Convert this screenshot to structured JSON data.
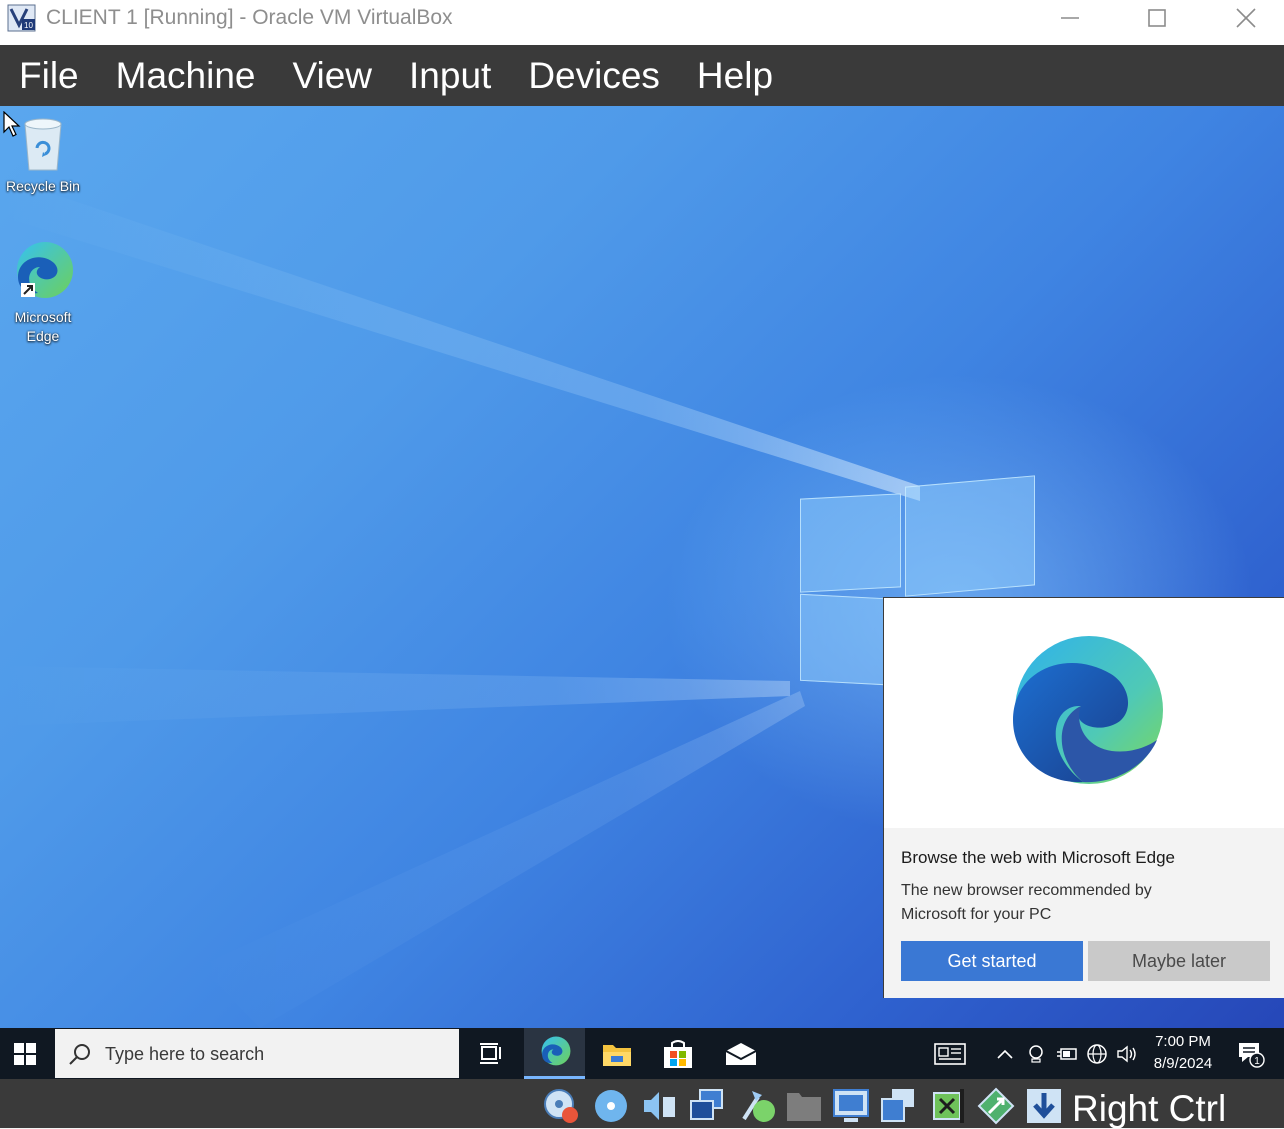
{
  "window": {
    "title": "CLIENT 1 [Running] - Oracle VM VirtualBox",
    "controls": [
      "minimize-icon",
      "maximize-icon",
      "close-icon"
    ]
  },
  "menubar": {
    "items": [
      "File",
      "Machine",
      "View",
      "Input",
      "Devices",
      "Help"
    ]
  },
  "desktop": {
    "icons": [
      {
        "label": "Recycle Bin",
        "icon": "recycle-bin-icon"
      },
      {
        "label_line1": "Microsoft",
        "label_line2": "Edge",
        "icon": "edge-icon"
      }
    ]
  },
  "edge_popup": {
    "heading": "Browse the web with Microsoft Edge",
    "body_line1": "The new browser recommended by",
    "body_line2": "Microsoft for your PC",
    "primary_button": "Get started",
    "secondary_button": "Maybe later"
  },
  "taskbar": {
    "search_placeholder": "Type here to search",
    "pinned": [
      "task-view-icon",
      "edge-icon",
      "file-explorer-icon",
      "store-icon",
      "mail-icon"
    ],
    "clock_time": "7:00 PM",
    "clock_date": "8/9/2024",
    "notification_count": "1"
  },
  "statusbar": {
    "host_key": "Right Ctrl",
    "icons": [
      "hard-disk-icon",
      "optical-drive-icon",
      "audio-icon",
      "network-icon",
      "usb-icon",
      "shared-folders-icon",
      "display-icon",
      "recording-icon",
      "cpu-icon",
      "mouse-integration-icon",
      "host-key-icon"
    ]
  },
  "colors": {
    "menubar_bg": "#3a3a3a",
    "taskbar_bg": "#101822",
    "accent_button": "#3a78d4"
  }
}
